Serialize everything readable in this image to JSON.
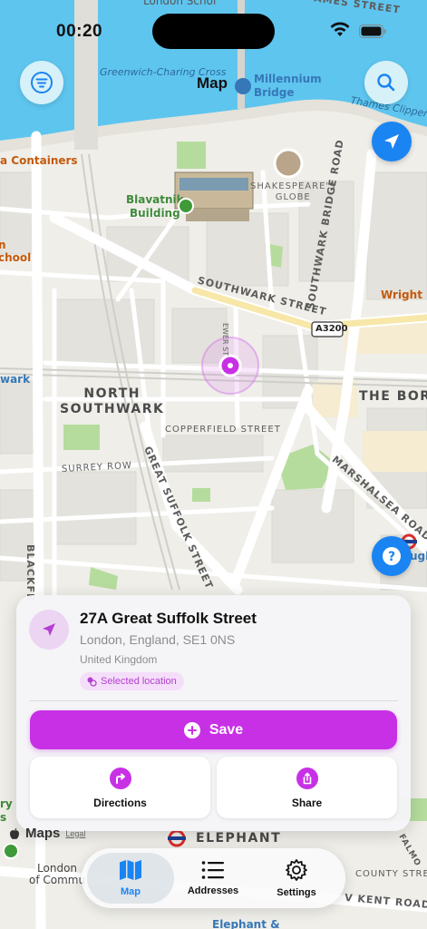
{
  "status_bar": {
    "time": "00:20"
  },
  "header": {
    "title": "Map"
  },
  "map": {
    "labels": {
      "london_school": "London Schol",
      "thames_st": "AMES STREET",
      "greenwich_charing": "Greenwich-Charing Cross",
      "millennium_bridge": "Millennium\nBridge",
      "thames_clippers": "Thames Clippers",
      "containers": "a Containers",
      "blavatnik": "Blavatnik\nBuilding",
      "globe": "SHAKESPEARE'S\nGLOBE",
      "school": "n\nchool",
      "southwark_bridge_rd": "SOUTHWARK BRIDGE ROAD",
      "wright_b": "Wright B",
      "southwark_st": "SOUTHWARK STREET",
      "a3200": "A3200",
      "lavington": "EWER ST",
      "wark": "wark",
      "north_southwark": "NORTH\nSOUTHWARK",
      "the_borough": "THE BOROU",
      "copperfield": "COPPERFIELD STREET",
      "surrey_row": "SURREY ROW",
      "great_suffolk": "GREAT SUFFOLK STREET",
      "marshalsea": "MARSHALSEA ROAD",
      "blackfriars": "BLACKFR",
      "gh": "ugh",
      "elephant": "ELEPHANT",
      "london_comm": "London\nof Commu",
      "county_st": "COUNTY STREET",
      "kent_road": "V KENT ROAD",
      "falmouth": "FALMO",
      "elephant_bottom": "Elephant &",
      "ry": "ry\ns"
    }
  },
  "location_card": {
    "title": "27A Great Suffolk Street",
    "address": "London, England, SE1 0NS",
    "country": "United Kingdom",
    "badge": "Selected location",
    "save_label": "Save",
    "directions_label": "Directions",
    "share_label": "Share"
  },
  "footer": {
    "maps_label": "Maps",
    "legal_label": "Legal"
  },
  "tab_bar": {
    "tabs": [
      {
        "label": "Map",
        "icon": "map-icon",
        "active": true
      },
      {
        "label": "Addresses",
        "icon": "list-icon",
        "active": false
      },
      {
        "label": "Settings",
        "icon": "gear-icon",
        "active": false
      }
    ]
  },
  "colors": {
    "accent": "#c830e6",
    "brand_blue": "#1a84f2",
    "water": "#5ec5ef"
  }
}
